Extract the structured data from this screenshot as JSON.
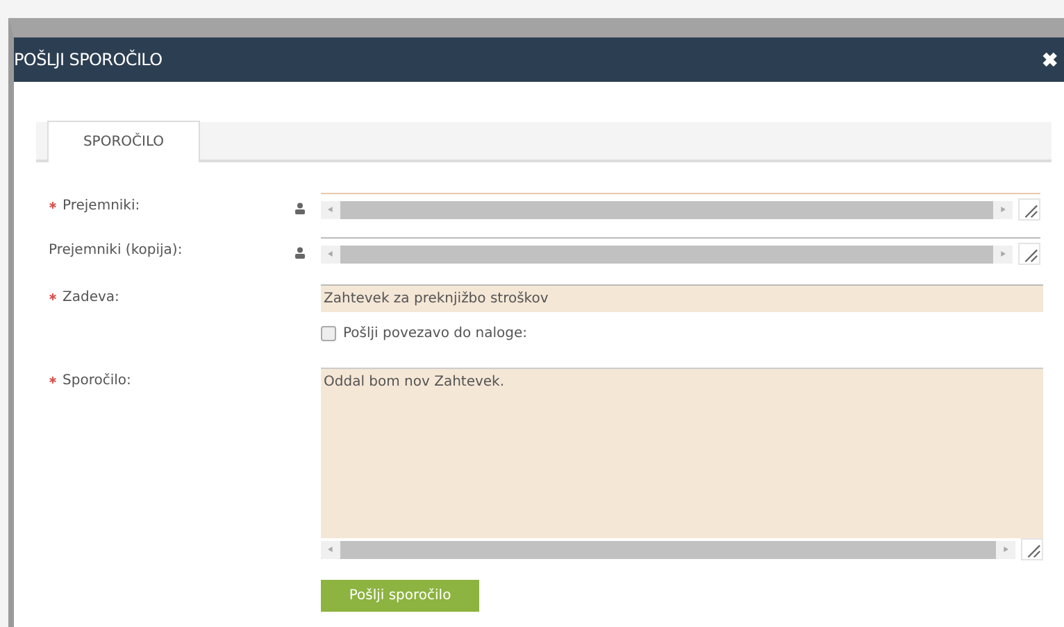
{
  "dialog": {
    "title": "POŠLJI SPOROČILO",
    "close": "✖"
  },
  "tabs": [
    {
      "label": "SPOROČILO",
      "selected": true
    }
  ],
  "fields": [
    {
      "kind": "recipients",
      "required": true,
      "label": "Prejemniki:"
    },
    {
      "kind": "recipients",
      "required": false,
      "label": "Prejemniki (kopija):"
    },
    {
      "kind": "text",
      "required": true,
      "label": "Zadeva:",
      "value": "Zahtevek za preknjižbo stroškov"
    },
    {
      "kind": "checkbox",
      "label": "Pošlji povezavo do naloge:",
      "checked": false
    },
    {
      "kind": "textarea",
      "required": true,
      "label": "Sporočilo:",
      "value": "Oddal bom nov Zahtevek."
    }
  ],
  "submit": "Pošlji sporočilo"
}
